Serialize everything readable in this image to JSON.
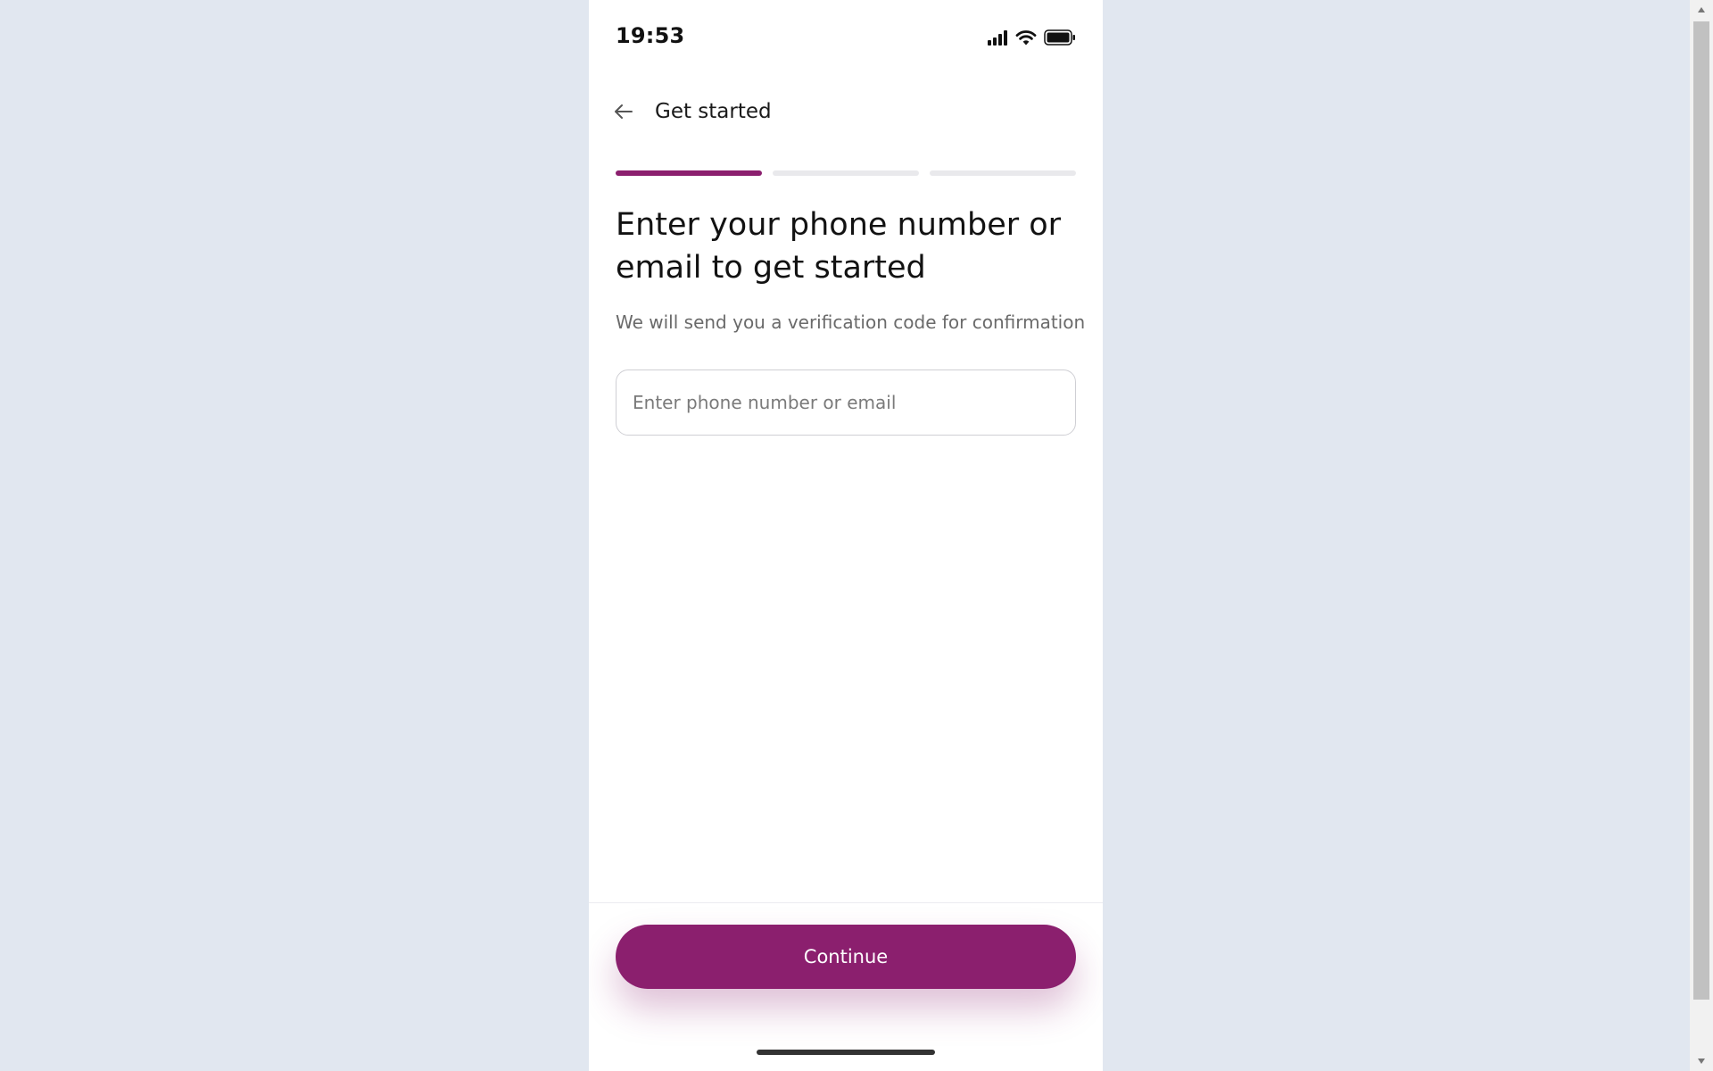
{
  "status_bar": {
    "time": "19:53",
    "icons": [
      "cellular-signal-icon",
      "wifi-icon",
      "battery-icon"
    ]
  },
  "header": {
    "back_icon": "arrow-left-icon",
    "title": "Get started"
  },
  "progress": {
    "total_steps": 3,
    "current_step": 1
  },
  "main": {
    "headline": "Enter your phone number or email to get started",
    "subtitle": "We will send you a verification code for confirmation",
    "input": {
      "placeholder": "Enter phone number or email",
      "value": ""
    }
  },
  "footer": {
    "continue_label": "Continue"
  },
  "colors": {
    "accent": "#8b1f6e",
    "page_background": "#e1e7f0",
    "screen_background": "#ffffff"
  }
}
